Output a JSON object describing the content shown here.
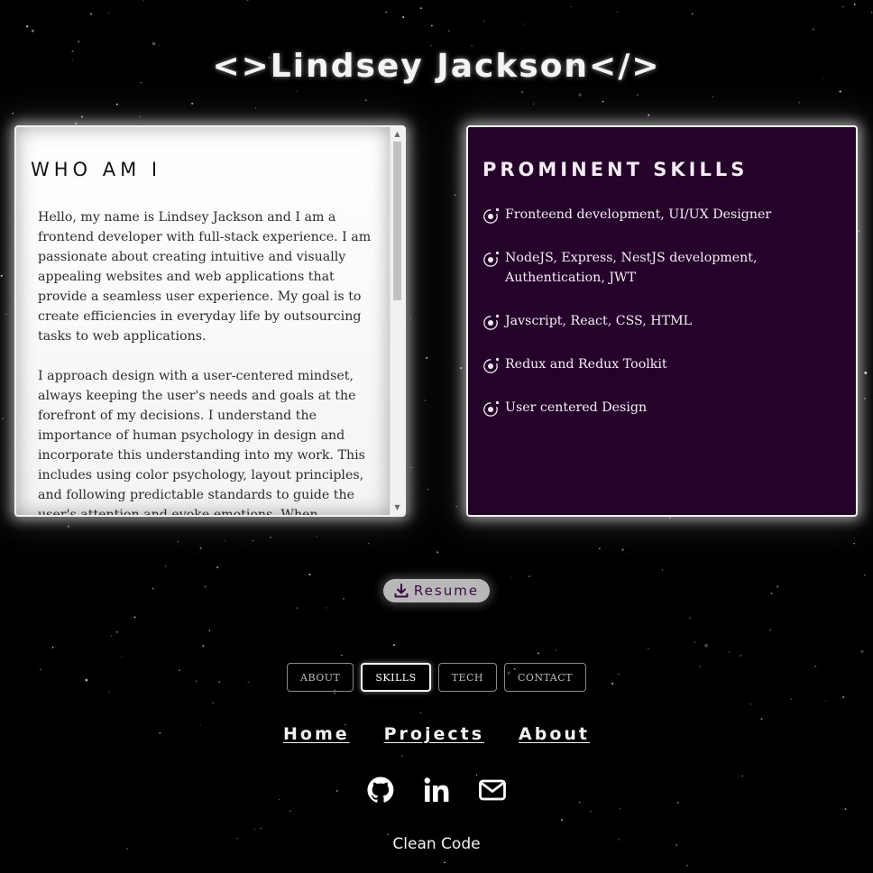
{
  "header": {
    "title": "<>Lindsey Jackson</>"
  },
  "about": {
    "heading": "WHO AM I",
    "paragraphs": [
      "Hello, my name is Lindsey Jackson and I am a frontend developer with full-stack experience. I am passionate about creating intuitive and visually appealing websites and web applications that provide a seamless user experience. My goal is to create efficiencies in everyday life by outsourcing tasks to web applications.",
      "I approach design with a user-centered mindset, always keeping the user's needs and goals at the forefront of my decisions. I understand the importance of human psychology in design and incorporate this understanding into my work. This includes using color psychology, layout principles, and following predictable standards to guide the user's attention and evoke emotions. When creating a user flow or interface layout, I aim for a logical and efficient order for users to"
    ]
  },
  "skills": {
    "heading": "PROMINENT SKILLS",
    "icon": "orbit-icon",
    "items": [
      "Fronteend development, UI/UX Designer",
      "NodeJS, Express, NestJS development, Authentication, JWT",
      "Javscript, React, CSS, HTML",
      "Redux and Redux Toolkit",
      "User centered Design"
    ]
  },
  "resume": {
    "label": "Resume",
    "icon": "download-icon"
  },
  "tabs": {
    "items": [
      {
        "label": "ABOUT",
        "active": false
      },
      {
        "label": "SKILLS",
        "active": true
      },
      {
        "label": "TECH",
        "active": false
      },
      {
        "label": "CONTACT",
        "active": false
      }
    ]
  },
  "nav": {
    "home": "Home",
    "projects": "Projects",
    "about": "About"
  },
  "social": {
    "icons": [
      "github-icon",
      "linkedin-icon",
      "mail-icon"
    ]
  },
  "footer": {
    "text": "Clean Code"
  },
  "colors": {
    "background": "#000000",
    "skills_card": "#25022a",
    "about_card": "#ffffff",
    "resume_text": "#3b0b44",
    "resume_button": "#b8b8b8"
  }
}
